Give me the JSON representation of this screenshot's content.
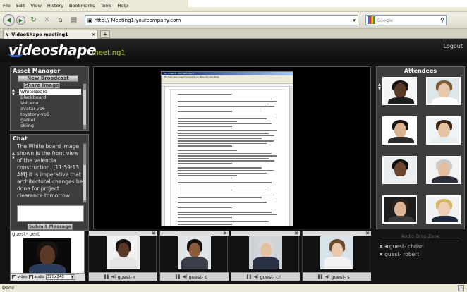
{
  "browser": {
    "menu": [
      "File",
      "Edit",
      "View",
      "History",
      "Bookmarks",
      "Tools",
      "Help"
    ],
    "url": "http:// Meeting1.yourcompany.com",
    "search_placeholder": "Google",
    "tab_title": "VideoShape meeting1",
    "status": "Done"
  },
  "app": {
    "logo_text": "videoshape",
    "meeting_name": "meeting1",
    "logout_label": "Logout"
  },
  "asset_manager": {
    "title": "Asset Manager",
    "new_broadcast_label": "New Broadcast",
    "share_image_label": "Share Image",
    "items": [
      {
        "label": "WhiteBoard",
        "selected": true
      },
      {
        "label": "Blackboard",
        "selected": false
      },
      {
        "label": "Volcano",
        "selected": false
      },
      {
        "label": "avatar-vp6",
        "selected": false
      },
      {
        "label": "toystory-vp6",
        "selected": false
      },
      {
        "label": "gamer",
        "selected": false
      },
      {
        "label": "skiing",
        "selected": false
      }
    ]
  },
  "chat": {
    "title": "Chat",
    "messages": "The White board image shown is the front view of the valencia construction. [11:59:13 AM] it is imperative that architectural changes be done for project clearance tomorrow",
    "submit_label": "Submit Message"
  },
  "whiteboard": {
    "doc_title": "Document1 - Microsoft Word",
    "doc_menu": "File  Edit  View  Insert  Format  Tools  Table  Window  Help"
  },
  "attendees": {
    "title": "Attendees",
    "list": [
      {
        "icon": "attendee-1-avatar",
        "skin": "#5a3a26",
        "hair": "#1a1210",
        "body": "#1d1d1d",
        "bg": "#f5f5f5"
      },
      {
        "icon": "attendee-2-avatar",
        "skin": "#e8c9ad",
        "hair": "#7a5a32",
        "body": "#ffffff",
        "bg": "#dde6ea"
      },
      {
        "icon": "attendee-3-avatar",
        "skin": "#d9b28f",
        "hair": "#17120e",
        "body": "#2a2a2a",
        "bg": "#ffffff"
      },
      {
        "icon": "attendee-4-avatar",
        "skin": "#e6c4a2",
        "hair": "#3a2414",
        "body": "#e7eef2",
        "bg": "#eef3f6"
      },
      {
        "icon": "attendee-5-avatar",
        "skin": "#6b4530",
        "hair": "#120d0b",
        "body": "#f0f0f0",
        "bg": "#e9edf0"
      },
      {
        "icon": "attendee-6-avatar",
        "skin": "#e3bea0",
        "hair": "#c9c9c9",
        "body": "#2b2f3a",
        "bg": "#f2f2f2"
      },
      {
        "icon": "attendee-7-avatar",
        "skin": "#dcb496",
        "hair": "#2f251c",
        "body": "#3a3a3a",
        "bg": "#1d1d1d"
      },
      {
        "icon": "attendee-8-avatar",
        "skin": "#efcfb2",
        "hair": "#d7b46a",
        "body": "#1d2838",
        "bg": "#f1f1f1"
      }
    ]
  },
  "audio_drop_zone": {
    "label": "Audio Drop Zone",
    "guests": [
      "guest- chrisd",
      "guest- robert"
    ]
  },
  "my_video": {
    "name": "guest- bert",
    "video_label": "video",
    "audio_label": "audio",
    "resolution": "320x240",
    "skin": "#5a3a26",
    "hair": "#1a1210",
    "body": "#2b3b5b"
  },
  "video_tiles": [
    {
      "name": "guest- r",
      "skin": "#5a3a26",
      "hair": "#151110",
      "body": "#e4e4e4",
      "bg": "#f0f0f0"
    },
    {
      "name": "guest- d",
      "skin": "#8a5a3a",
      "hair": "#141010",
      "body": "#3a3f4a",
      "bg": "#dfe4e6"
    },
    {
      "name": "guest- ch",
      "skin": "#e2c0a0",
      "hair": "#d8d8d8",
      "body": "#2b3144",
      "bg": "#cfd4d8"
    },
    {
      "name": "guest- s",
      "skin": "#e9c8aa",
      "hair": "#6b4a2c",
      "body": "#f2f2f2",
      "bg": "#d8e3ea"
    }
  ],
  "colors": {
    "accent_green": "#b5d03a",
    "logo_blue": "#2f5fc7"
  }
}
